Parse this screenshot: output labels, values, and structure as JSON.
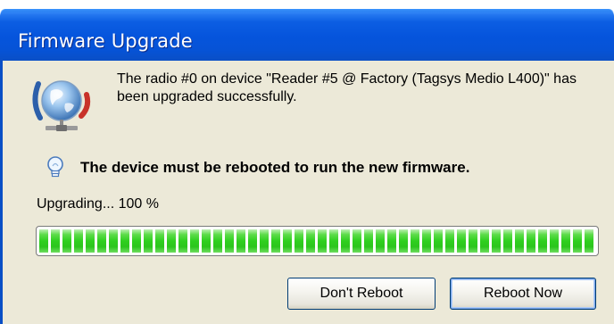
{
  "window": {
    "title": "Firmware Upgrade"
  },
  "message": {
    "text": "The radio #0 on device \"Reader #5 @ Factory (Tagsys Medio L400)\" has been upgraded successfully.",
    "icon": "network-globe-icon"
  },
  "notice": {
    "text": "The device must be rebooted to run the new firmware.",
    "icon": "lightbulb-icon"
  },
  "progress": {
    "label": "Upgrading... 100 %",
    "value_percent": 100,
    "color": "#2fcf1f"
  },
  "buttons": {
    "dont_reboot": "Don't Reboot",
    "reboot_now": "Reboot Now"
  },
  "colors": {
    "titlebar": "#0554dc",
    "dialog_background": "#ece9d8"
  }
}
